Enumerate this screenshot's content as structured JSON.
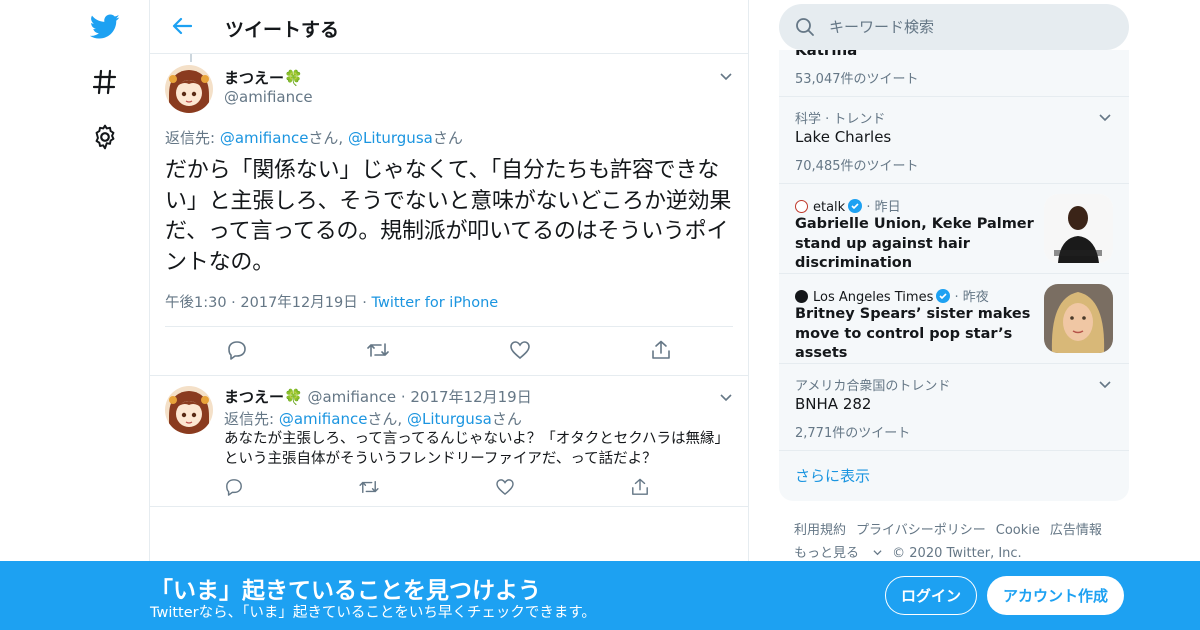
{
  "nav": {
    "logo_icon": "twitter-bird-icon",
    "explore_icon": "hashtag-icon",
    "settings_icon": "gear-icon"
  },
  "header": {
    "title": "ツイートする",
    "back_icon": "back-arrow-icon"
  },
  "focused_tweet": {
    "display_name": "まつえー🍀",
    "handle": "@amifiance",
    "reply_prefix": "返信先: ",
    "reply_user1": "@amifiance",
    "reply_san1": "さん, ",
    "reply_user2": "@Liturgusa",
    "reply_san2": "さん",
    "text": "だから「関係ない」じゃなくて、「自分たちも許容できない」と主張しろ、そうでないと意味がないどころか逆効果だ、って言ってるの。規制派が叩いてるのはそういうポイントなの。",
    "time": "午後1:30",
    "date": "2017年12月19日",
    "client": "Twitter for iPhone"
  },
  "reply_tweet": {
    "display_name": "まつえー🍀",
    "handle": "@amifiance",
    "date": "2017年12月19日",
    "reply_prefix": "返信先: ",
    "reply_user1": "@amifiance",
    "reply_san1": "さん, ",
    "reply_user2": "@Liturgusa",
    "reply_san2": "さん",
    "text": "あなたが主張しろ、って言ってるんじゃないよ？「オタクとセクハラは無縁」という主張自体がそういうフレンドリーファイアだ、って話だよ？"
  },
  "search": {
    "placeholder": "キーワード検索"
  },
  "trends": {
    "partial_name": "Katrina",
    "items": [
      {
        "count": "53,047件のツイート"
      },
      {
        "category": "科学 · トレンド",
        "name": "Lake Charles",
        "count": "70,485件のツイート"
      },
      {
        "source": "etalk",
        "when": "昨日",
        "headline": "Gabrielle Union, Keke Palmer stand up against hair discrimination"
      },
      {
        "source": "Los Angeles Times",
        "when": "昨夜",
        "headline": "Britney Spears’ sister makes move to control pop star’s assets"
      },
      {
        "category": "アメリカ合衆国のトレンド",
        "name": "BNHA 282",
        "count": "2,771件のツイート"
      }
    ],
    "show_more": "さらに表示"
  },
  "footer": {
    "terms": "利用規約",
    "privacy": "プライバシーポリシー",
    "cookie": "Cookie",
    "ads": "広告情報",
    "more": "もっと見る",
    "copyright": "© 2020 Twitter, Inc."
  },
  "bottom_bar": {
    "title": "「いま」起きていることを見つけよう",
    "subtitle": "Twitterなら、「いま」起きていることをいち早くチェックできます。",
    "login": "ログイン",
    "signup": "アカウント作成",
    "color": "#1da1f2"
  }
}
